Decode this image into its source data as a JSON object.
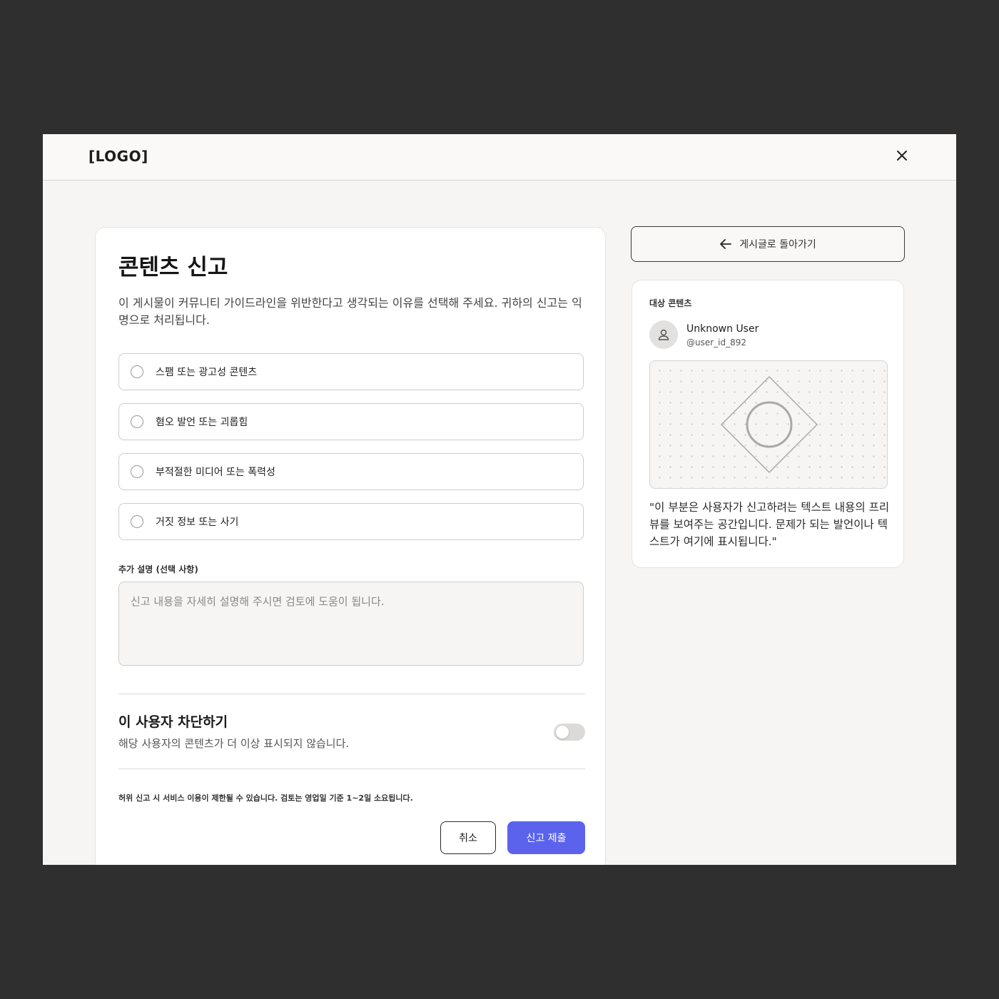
{
  "app": {
    "logo": "[LOGO]"
  },
  "report": {
    "title": "콘텐츠 신고",
    "description": "이 게시물이 커뮤니티 가이드라인을 위반한다고 생각되는 이유를 선택해 주세요. 귀하의 신고는 익명으로 처리됩니다.",
    "options": [
      {
        "label": "스팸 또는 광고성 콘텐츠"
      },
      {
        "label": "혐오 발언 또는 괴롭힘"
      },
      {
        "label": "부적절한 미디어 또는 폭력성"
      },
      {
        "label": "거짓 정보 또는 사기"
      }
    ],
    "extra_label": "추가 설명 (선택 사항)",
    "extra_placeholder": "신고 내용을 자세히 설명해 주시면 검토에 도움이 됩니다.",
    "extra_value": "",
    "block_title": "이 사용자 차단하기",
    "block_desc": "해당 사용자의 콘텐츠가 더 이상 표시되지 않습니다.",
    "block_enabled": false,
    "warning": "허위 신고 시 서비스 이용이 제한될 수 있습니다. 검토는 영업일 기준 1~2일 소요됩니다.",
    "cancel_label": "취소",
    "submit_label": "신고 제출"
  },
  "sidebar": {
    "back_label": "게시글로 돌아가기",
    "target_label": "대상 콘텐츠",
    "user_name": "Unknown User",
    "user_handle": "@user_id_892",
    "quote": "\"이 부분은 사용자가 신고하려는 텍스트 내용의 프리뷰를 보여주는 공간입니다. 문제가 되는 발언이나 텍스트가 여기에 표시됩니다.\""
  },
  "icons": {
    "close": "close-icon",
    "back": "arrow-left-icon",
    "avatar": "user-icon",
    "media": "image-placeholder-icon"
  },
  "colors": {
    "accent": "#5b63ec",
    "page_background": "#f6f5f3",
    "outer_background": "#2f2f2f"
  }
}
